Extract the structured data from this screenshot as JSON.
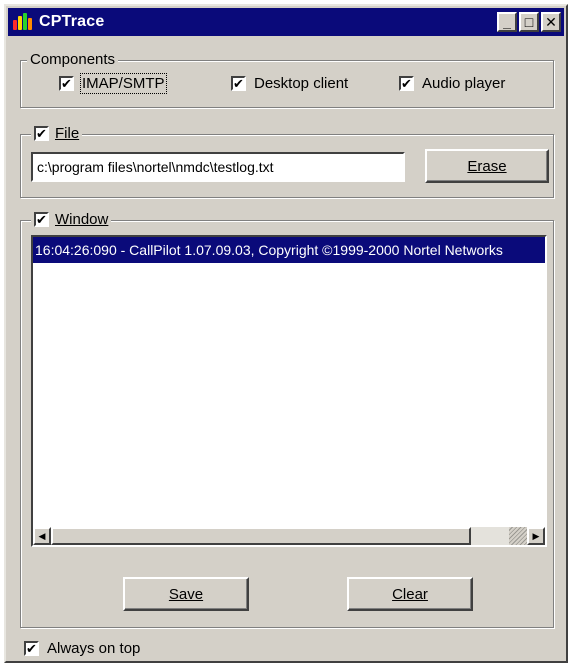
{
  "window": {
    "title": "CPTrace",
    "controls": [
      "_",
      "□",
      "✕"
    ]
  },
  "components": {
    "legend": "Components",
    "items": [
      {
        "label": "IMAP/SMTP",
        "checked": true
      },
      {
        "label": "Desktop client",
        "checked": true
      },
      {
        "label": "Audio player",
        "checked": true
      }
    ]
  },
  "file": {
    "legend": "File",
    "checked": true,
    "path": "c:\\program files\\nortel\\nmdc\\testlog.txt",
    "erase_label": "Erase"
  },
  "window_group": {
    "legend": "Window",
    "checked": true,
    "log_lines": [
      "16:04:26:090 - CallPilot 1.07.09.03, Copyright ©1999-2000 Nortel Networks"
    ]
  },
  "buttons": {
    "save_label": "Save",
    "clear_label": "Clear"
  },
  "always_on_top": {
    "label": "Always on top",
    "checked": true
  },
  "icons": {
    "check": "✔",
    "arrow_left": "◀",
    "arrow_right": "▶"
  }
}
